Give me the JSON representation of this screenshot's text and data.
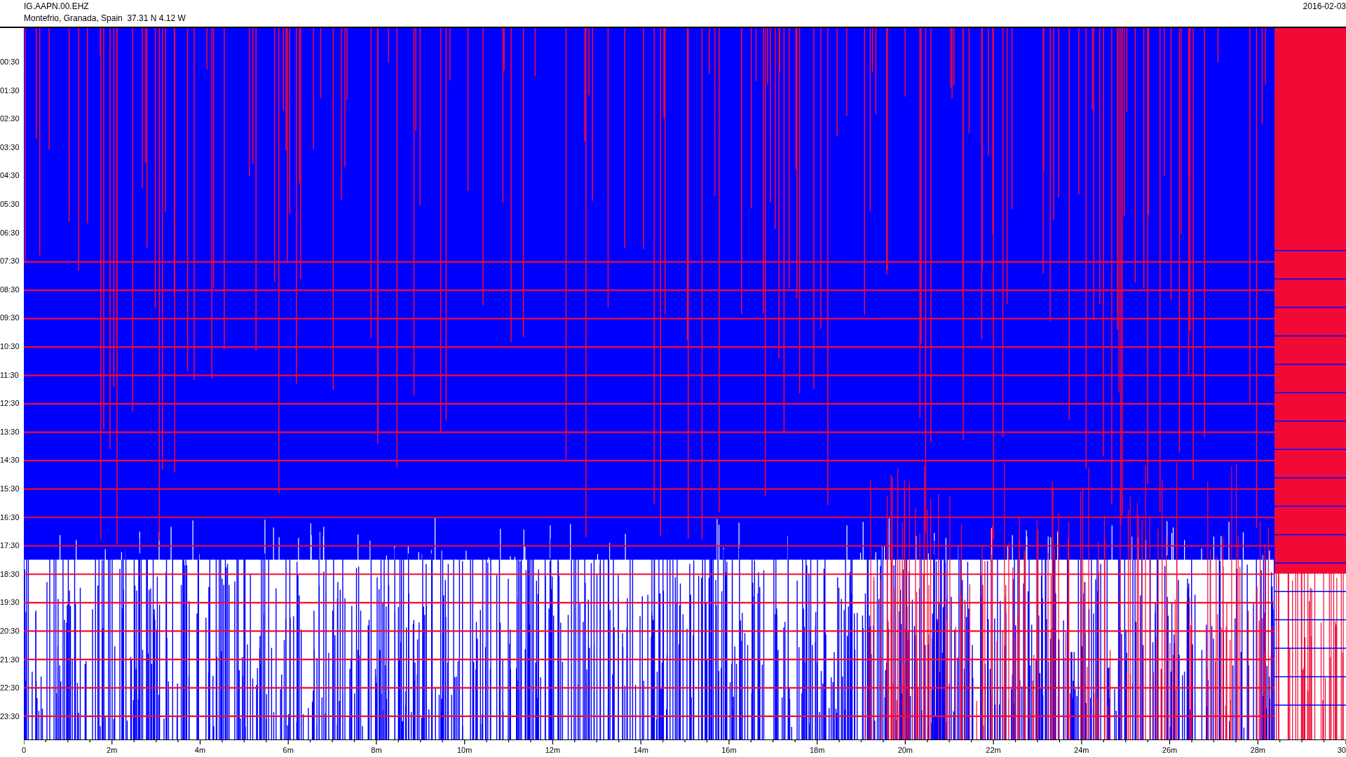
{
  "header": {
    "station": "IG.AAPN.00.EHZ",
    "location": "Montefrio, Granada, Spain  37.31 N 4.12 W",
    "date": "2016-02-03"
  },
  "y_labels": [
    "00:30",
    "01:30",
    "02:30",
    "03:30",
    "04:30",
    "05:30",
    "06:30",
    "07:30",
    "08:30",
    "09:30",
    "10:30",
    "11:30",
    "12:30",
    "13:30",
    "14:30",
    "15:30",
    "16:30",
    "17:30",
    "18:30",
    "19:30",
    "20:30",
    "21:30",
    "22:30",
    "23:30"
  ],
  "x_labels": [
    "0",
    "2m",
    "4m",
    "6m",
    "8m",
    "10m",
    "12m",
    "14m",
    "16m",
    "18m",
    "20m",
    "22m",
    "24m",
    "26m",
    "28m",
    "30"
  ]
}
